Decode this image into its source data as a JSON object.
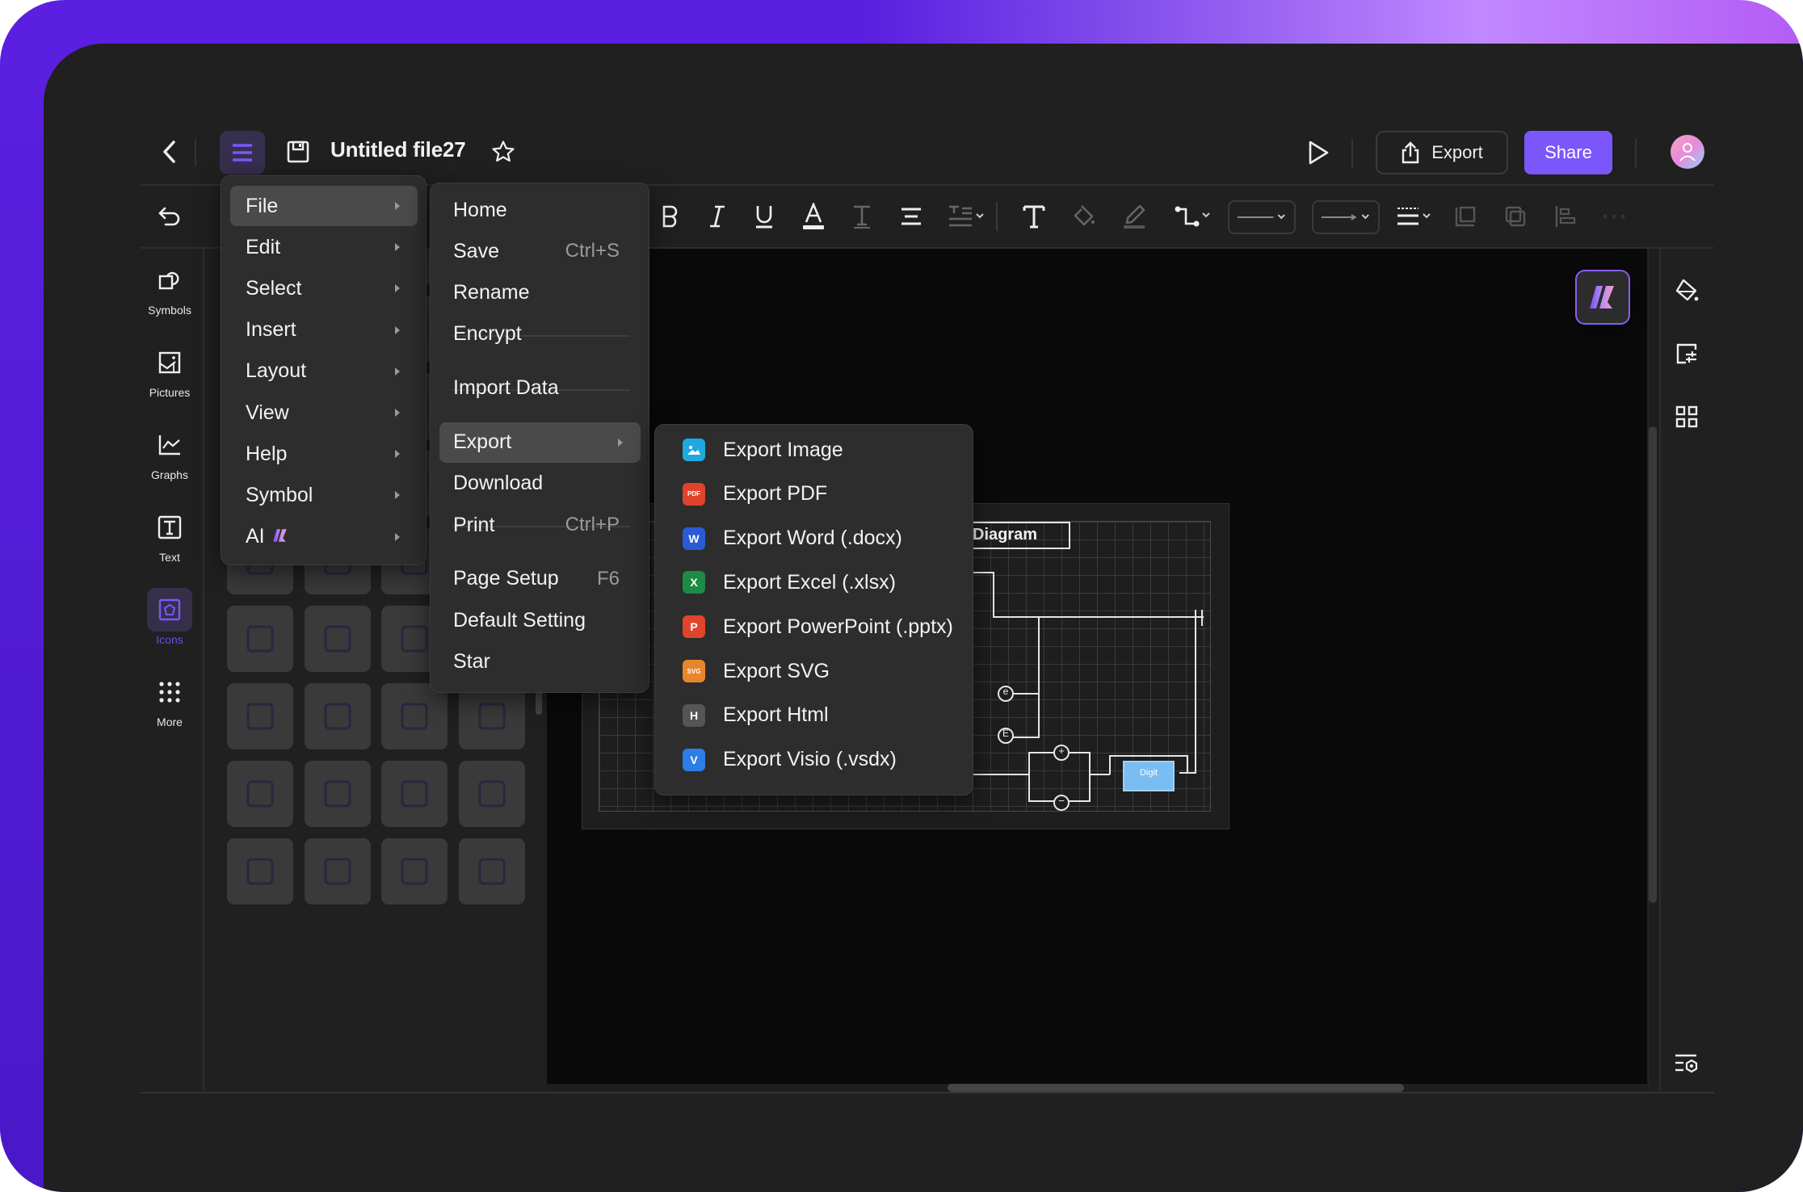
{
  "header": {
    "title": "Untitled file27",
    "export_label": "Export",
    "share_label": "Share",
    "icons": [
      "back-chevron-icon",
      "hamburger-menu-icon",
      "save-icon",
      "star-icon",
      "play-icon",
      "export-upload-icon",
      "avatar"
    ]
  },
  "colors": {
    "accent": "#7b57fb",
    "menu_button_bg": "#362f4f",
    "app_bg": "#202020",
    "canvas_bg": "#0a0a0a",
    "menu_bg": "#2d2d2d",
    "menu_highlight": "#4a4a4a"
  },
  "toolbar": {
    "tools": [
      "undo",
      "bold",
      "italic",
      "underline",
      "font-color",
      "text-style",
      "align",
      "line-spacing",
      "text",
      "fill",
      "line-color",
      "connector",
      "line-style",
      "arrow-style",
      "line-weight",
      "bring-front",
      "send-back",
      "align-objects",
      "more"
    ]
  },
  "left_nav": {
    "items": [
      {
        "label": "Symbols",
        "icon": "symbols-icon",
        "active": false
      },
      {
        "label": "Pictures",
        "icon": "pictures-icon",
        "active": false
      },
      {
        "label": "Graphs",
        "icon": "graphs-icon",
        "active": false
      },
      {
        "label": "Text",
        "icon": "text-icon",
        "active": false
      },
      {
        "label": "Icons",
        "icon": "icons-icon",
        "active": true
      },
      {
        "label": "More",
        "icon": "more-grid-icon",
        "active": false
      }
    ]
  },
  "main_menu": {
    "items": [
      {
        "label": "File",
        "has_submenu": true,
        "highlighted": true
      },
      {
        "label": "Edit",
        "has_submenu": true
      },
      {
        "label": "Select",
        "has_submenu": true
      },
      {
        "label": "Insert",
        "has_submenu": true
      },
      {
        "label": "Layout",
        "has_submenu": true
      },
      {
        "label": "View",
        "has_submenu": true
      },
      {
        "label": "Help",
        "has_submenu": true
      },
      {
        "label": "Symbol",
        "has_submenu": true
      },
      {
        "label": "AI",
        "has_submenu": true
      }
    ]
  },
  "file_menu": {
    "items": [
      {
        "label": "Home"
      },
      {
        "label": "Save",
        "shortcut": "Ctrl+S"
      },
      {
        "label": "Rename"
      },
      {
        "label": "Encrypt"
      },
      {
        "label": "Import Data"
      },
      {
        "label": "Export",
        "has_submenu": true,
        "highlighted": true
      },
      {
        "label": "Download"
      },
      {
        "label": "Print",
        "shortcut": "Ctrl+P"
      },
      {
        "label": "Page Setup",
        "shortcut": "F6"
      },
      {
        "label": "Default Setting"
      },
      {
        "label": "Star"
      }
    ]
  },
  "export_menu": {
    "items": [
      {
        "label": "Export Image",
        "badge": "",
        "color": "#1fa9e0"
      },
      {
        "label": "Export PDF",
        "badge": "PDF",
        "color": "#e0432c"
      },
      {
        "label": "Export Word (.docx)",
        "badge": "W",
        "color": "#2a5bd4"
      },
      {
        "label": "Export Excel (.xlsx)",
        "badge": "X",
        "color": "#1d8a45"
      },
      {
        "label": "Export PowerPoint (.pptx)",
        "badge": "P",
        "color": "#e0452b"
      },
      {
        "label": "Export SVG",
        "badge": "SVG",
        "color": "#e8862e"
      },
      {
        "label": "Export Html",
        "badge": "H",
        "color": "#555555"
      },
      {
        "label": "Export Visio (.vsdx)",
        "badge": "V",
        "color": "#2d7de6"
      }
    ]
  },
  "canvas": {
    "diagram_title": "Diagram",
    "digit_label": "Digit",
    "node_labels": [
      "e",
      "E",
      "+",
      "−"
    ]
  },
  "right_panel": {
    "icons": [
      "fill-bucket-icon",
      "format-panel-icon",
      "grid-apps-icon",
      "settings-list-icon"
    ]
  }
}
